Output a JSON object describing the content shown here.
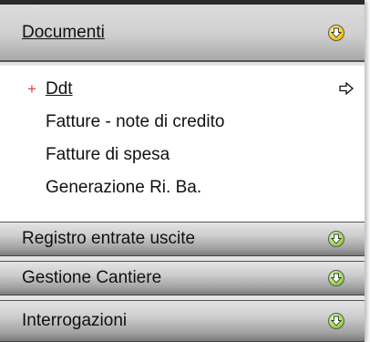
{
  "menu": {
    "sections": [
      {
        "label": "Documenti",
        "expanded": true,
        "icon": "yellow-collapse-circle-icon",
        "color": "#f2c400"
      },
      {
        "label": "Registro entrate uscite",
        "expanded": false,
        "icon": "green-expand-circle-icon",
        "color": "#8ed23d"
      },
      {
        "label": "Gestione Cantiere",
        "expanded": false,
        "icon": "green-expand-circle-icon",
        "color": "#8ed23d"
      },
      {
        "label": "Interrogazioni",
        "expanded": false,
        "icon": "green-expand-circle-icon",
        "color": "#8ed23d"
      }
    ],
    "documenti_items": [
      {
        "label": "Ddt",
        "active": true
      },
      {
        "label": "Fatture - note di credito",
        "active": false
      },
      {
        "label": "Fatture di spesa",
        "active": false
      },
      {
        "label": "Generazione Ri. Ba.",
        "active": false
      }
    ],
    "active_bullet": "+",
    "accent_color": "#e23b3b"
  }
}
